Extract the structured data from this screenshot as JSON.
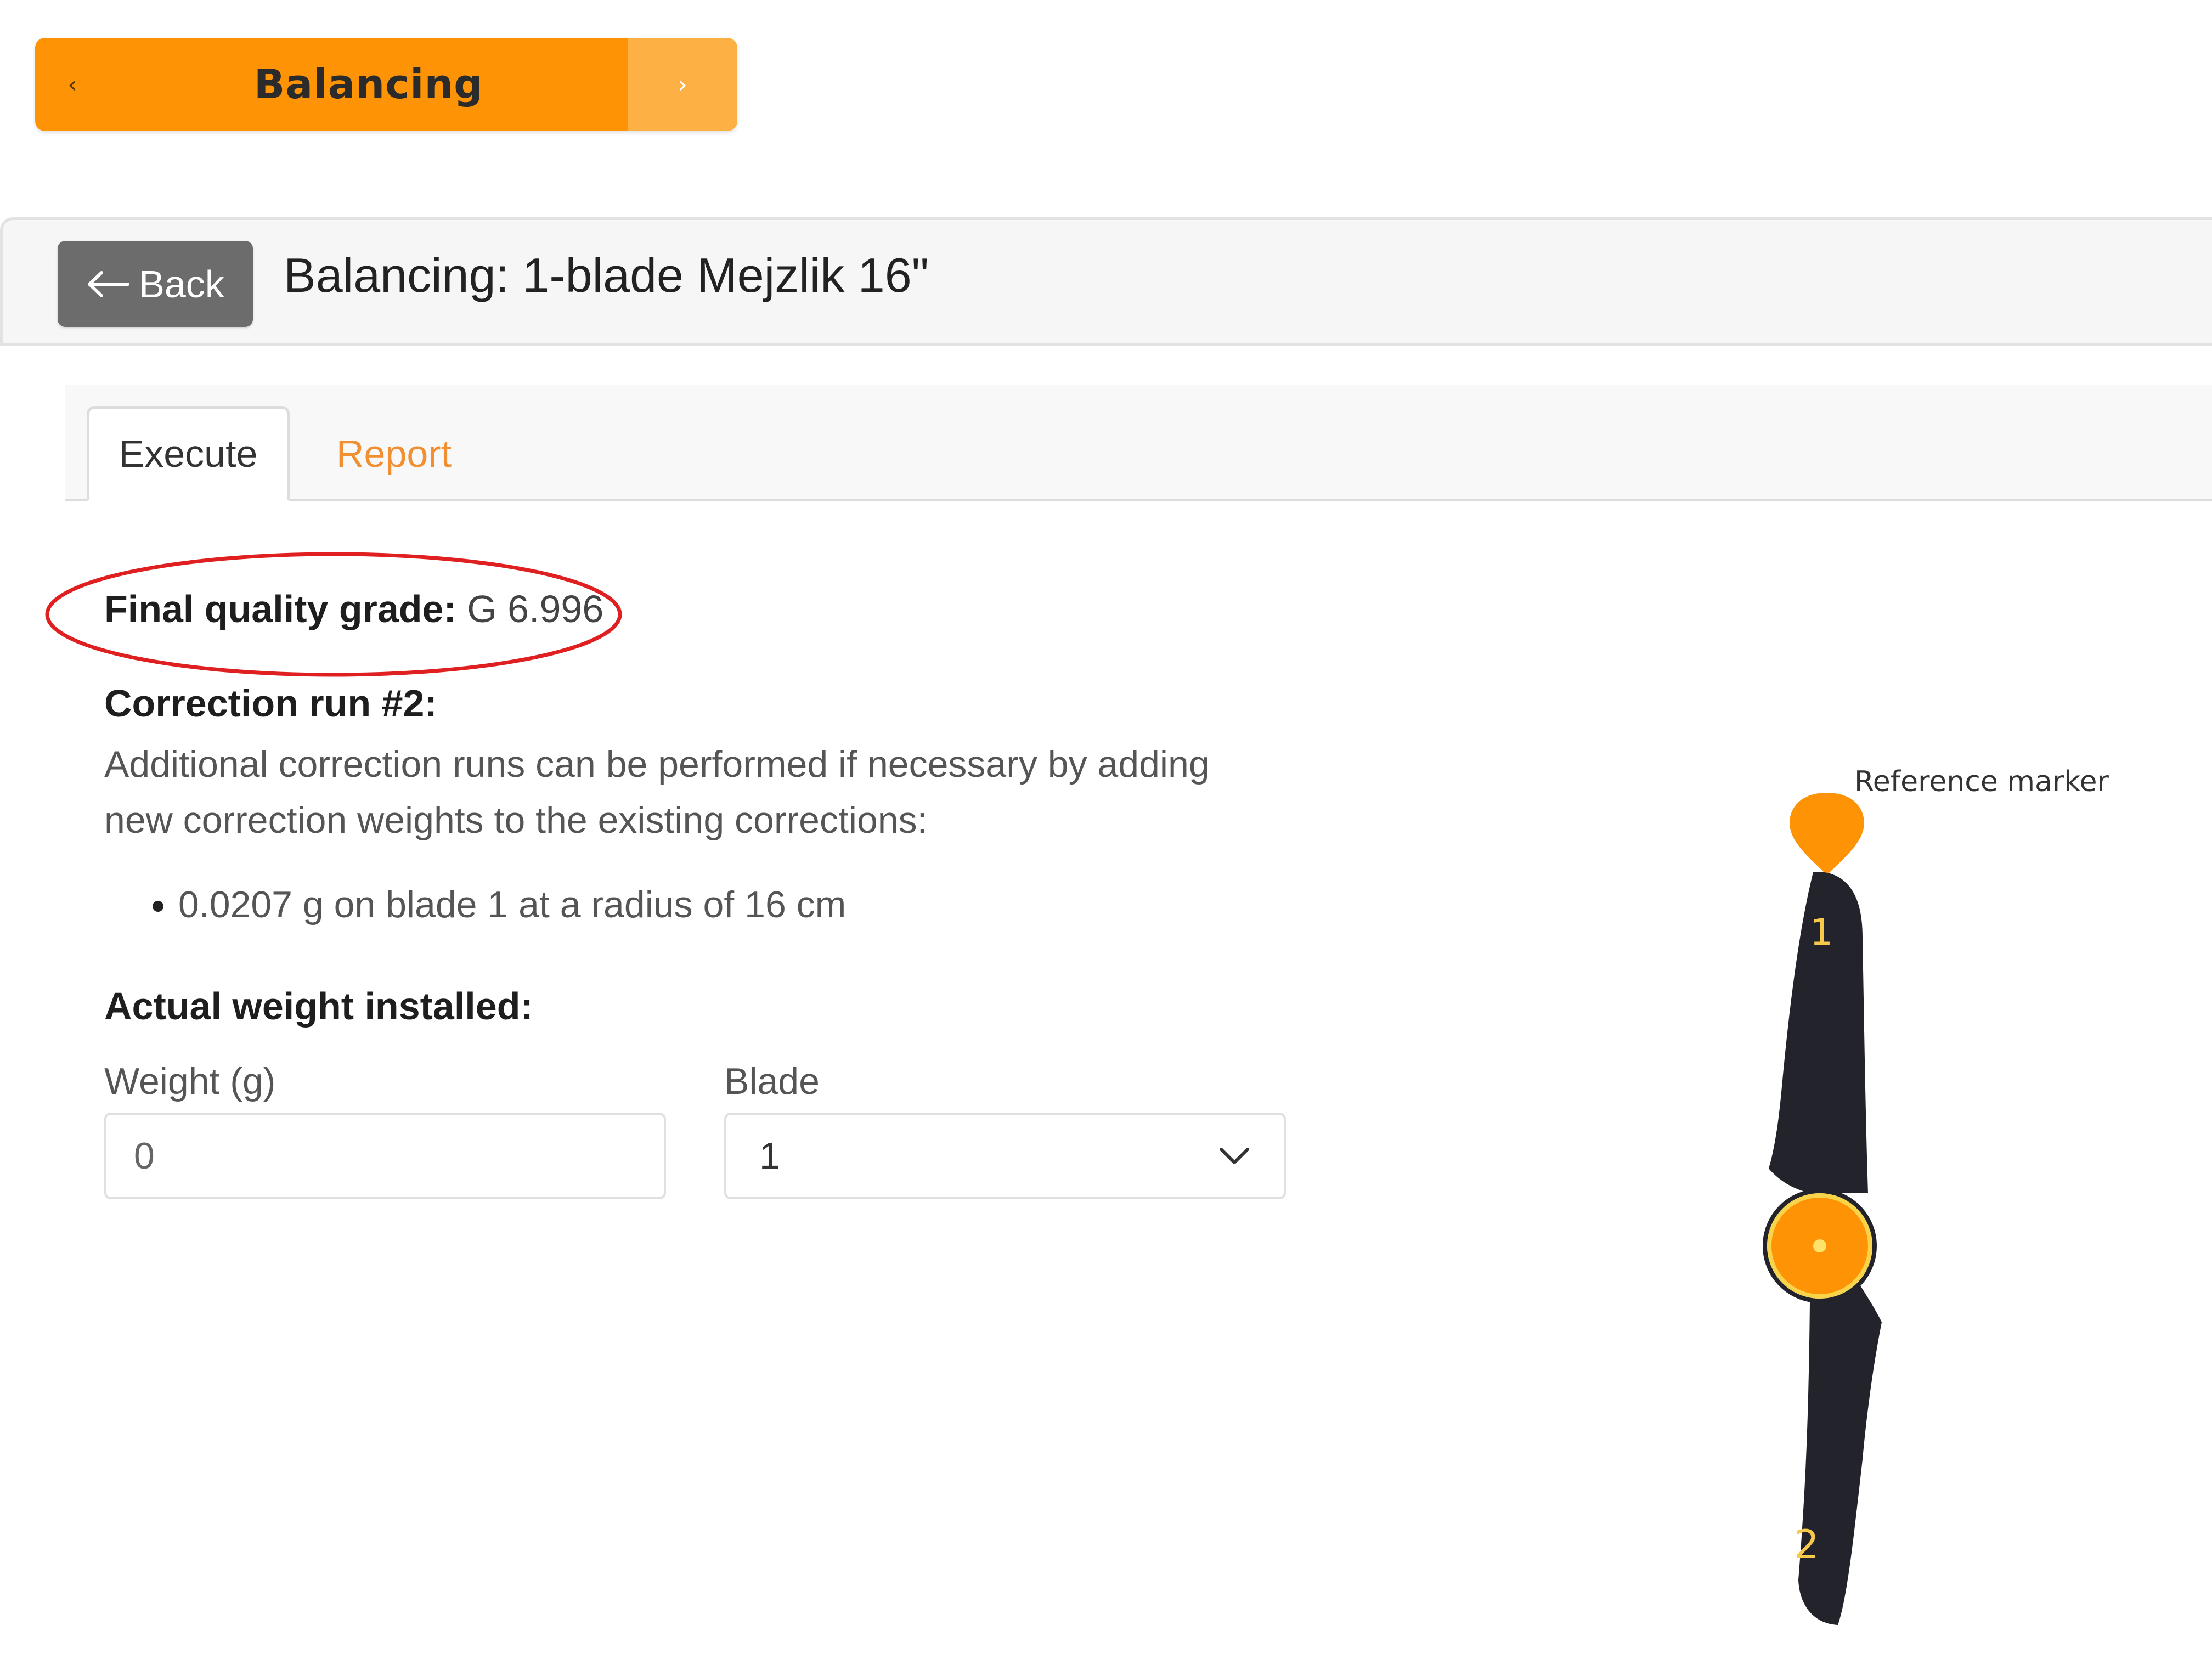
{
  "nav": {
    "prev_icon": "chevron-left-icon",
    "prev_glyph": "‹",
    "title": "Balancing",
    "next_icon": "chevron-right-icon",
    "next_glyph": "›",
    "accent_color": "#fe9305"
  },
  "header": {
    "back_label": "Back",
    "back_icon": "arrow-left-icon",
    "title": "Balancing: 1-blade Mejzlik 16\""
  },
  "tabs": [
    {
      "label": "Execute",
      "active": true
    },
    {
      "label": "Report",
      "active": false
    }
  ],
  "result": {
    "grade_label": "Final quality grade:",
    "grade_value": "G 6.996",
    "highlight_color": "#e02020"
  },
  "correction": {
    "title": "Correction run #2:",
    "description": "Additional correction runs can be performed if necessary by adding new correction weights to the existing corrections:",
    "items": [
      "0.0207 g on blade 1 at a radius of 16 cm"
    ]
  },
  "actual_weight": {
    "title": "Actual weight installed:",
    "weight_label": "Weight (g)",
    "weight_placeholder": "0",
    "blade_label": "Blade",
    "blade_value": "1",
    "blade_icon": "chevron-down-icon"
  },
  "diagram": {
    "reference_label": "Reference marker",
    "blade_1_label": "1",
    "blade_2_label": "2",
    "blade_color": "#23232b",
    "hub_color": "#fe9305",
    "marker_color": "#fe9305"
  }
}
